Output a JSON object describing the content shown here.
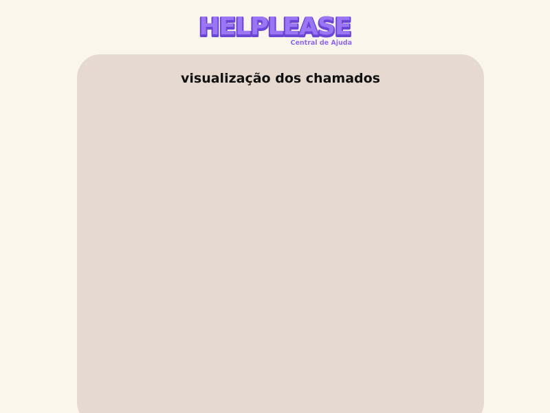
{
  "brand": {
    "name": "HELPLEASE",
    "tagline": "Central de Ajuda",
    "accent_color": "#8e67f0",
    "highlight_color": "#b79cff",
    "outline_color": "#6b45d6"
  },
  "panel": {
    "title": "visualização dos chamados",
    "background_color": "#e6d9d0"
  },
  "page": {
    "background_color": "#faf6eb"
  }
}
